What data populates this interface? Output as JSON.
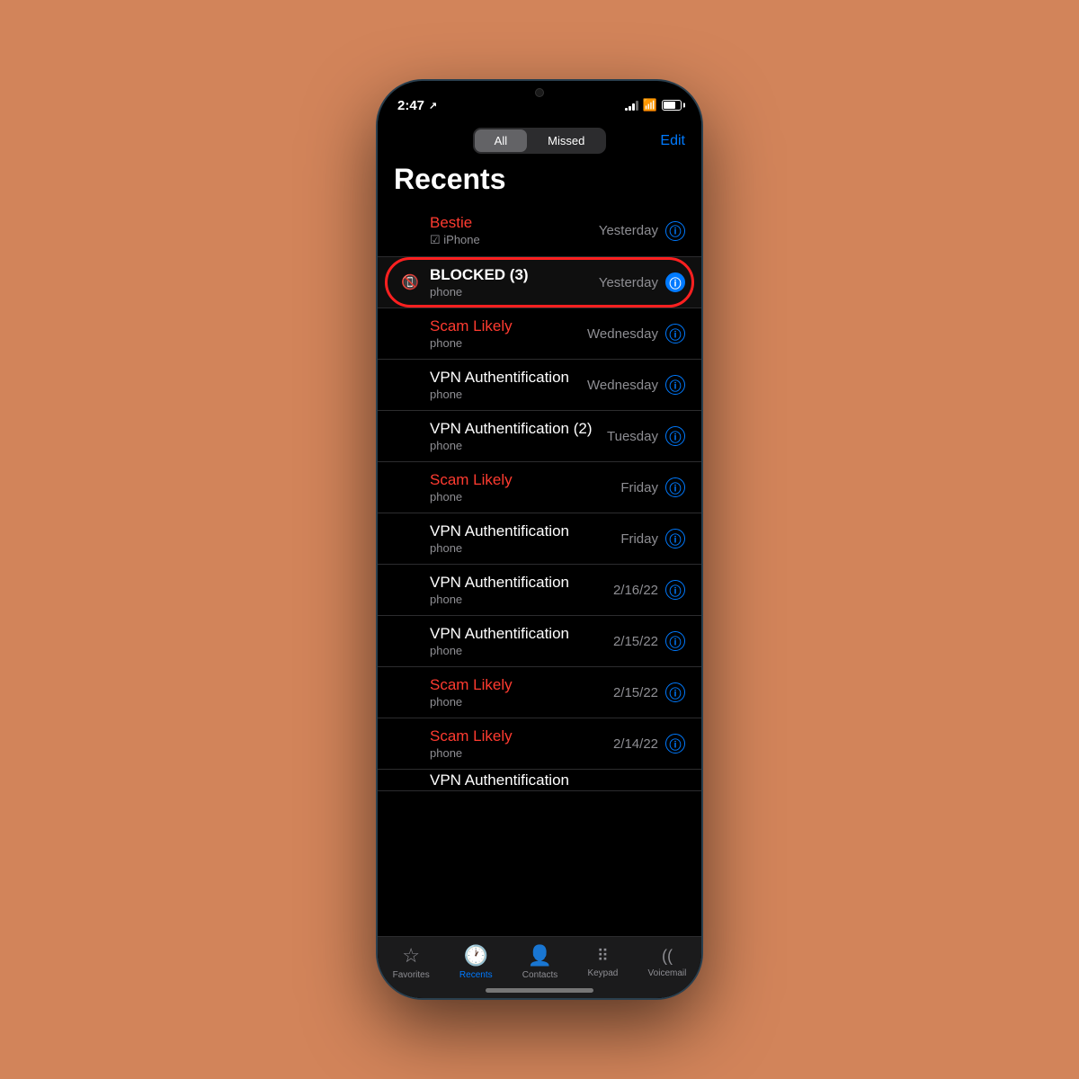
{
  "background": "#D2845A",
  "status_bar": {
    "time": "2:47",
    "location_active": true
  },
  "segment_control": {
    "all_label": "All",
    "missed_label": "Missed",
    "edit_label": "Edit",
    "active": "All"
  },
  "page_title": "Recents",
  "call_items": [
    {
      "id": "bestie",
      "name": "Bestie",
      "name_color": "red",
      "sub": "iPhone",
      "has_check": true,
      "date": "Yesterday",
      "highlighted": false,
      "has_phone_icon": false
    },
    {
      "id": "blocked",
      "name": "BLOCKED (3)",
      "name_color": "white-bold",
      "sub": "phone",
      "has_check": false,
      "date": "Yesterday",
      "highlighted": true,
      "has_phone_icon": true
    },
    {
      "id": "scam-wednesday",
      "name": "Scam Likely",
      "name_color": "red",
      "sub": "phone",
      "has_check": false,
      "date": "Wednesday",
      "highlighted": false,
      "has_phone_icon": false
    },
    {
      "id": "vpn-wednesday",
      "name": "VPN Authentification",
      "name_color": "white",
      "sub": "phone",
      "has_check": false,
      "date": "Wednesday",
      "highlighted": false,
      "has_phone_icon": false
    },
    {
      "id": "vpn-tuesday",
      "name": "VPN Authentification (2)",
      "name_color": "white",
      "sub": "phone",
      "has_check": false,
      "date": "Tuesday",
      "highlighted": false,
      "has_phone_icon": false
    },
    {
      "id": "scam-friday",
      "name": "Scam Likely",
      "name_color": "red",
      "sub": "phone",
      "has_check": false,
      "date": "Friday",
      "highlighted": false,
      "has_phone_icon": false
    },
    {
      "id": "vpn-friday",
      "name": "VPN Authentification",
      "name_color": "white",
      "sub": "phone",
      "has_check": false,
      "date": "Friday",
      "highlighted": false,
      "has_phone_icon": false
    },
    {
      "id": "vpn-216",
      "name": "VPN Authentification",
      "name_color": "white",
      "sub": "phone",
      "has_check": false,
      "date": "2/16/22",
      "highlighted": false,
      "has_phone_icon": false
    },
    {
      "id": "vpn-215",
      "name": "VPN Authentification",
      "name_color": "white",
      "sub": "phone",
      "has_check": false,
      "date": "2/15/22",
      "highlighted": false,
      "has_phone_icon": false
    },
    {
      "id": "scam-215",
      "name": "Scam Likely",
      "name_color": "red",
      "sub": "phone",
      "has_check": false,
      "date": "2/15/22",
      "highlighted": false,
      "has_phone_icon": false
    },
    {
      "id": "scam-214",
      "name": "Scam Likely",
      "name_color": "red",
      "sub": "phone",
      "has_check": false,
      "date": "2/14/22",
      "highlighted": false,
      "has_phone_icon": false
    },
    {
      "id": "vpn-partial",
      "name": "VPN Authentification",
      "name_color": "white",
      "sub": "phone",
      "has_check": false,
      "date": "",
      "highlighted": false,
      "has_phone_icon": false,
      "partial": true
    }
  ],
  "tab_bar": {
    "items": [
      {
        "id": "favorites",
        "label": "Favorites",
        "icon": "★",
        "active": false
      },
      {
        "id": "recents",
        "label": "Recents",
        "icon": "🕐",
        "active": true
      },
      {
        "id": "contacts",
        "label": "Contacts",
        "icon": "👤",
        "active": false
      },
      {
        "id": "keypad",
        "label": "Keypad",
        "icon": "⠿",
        "active": false
      },
      {
        "id": "voicemail",
        "label": "Voicemail",
        "icon": "⊃⊃",
        "active": false
      }
    ]
  }
}
